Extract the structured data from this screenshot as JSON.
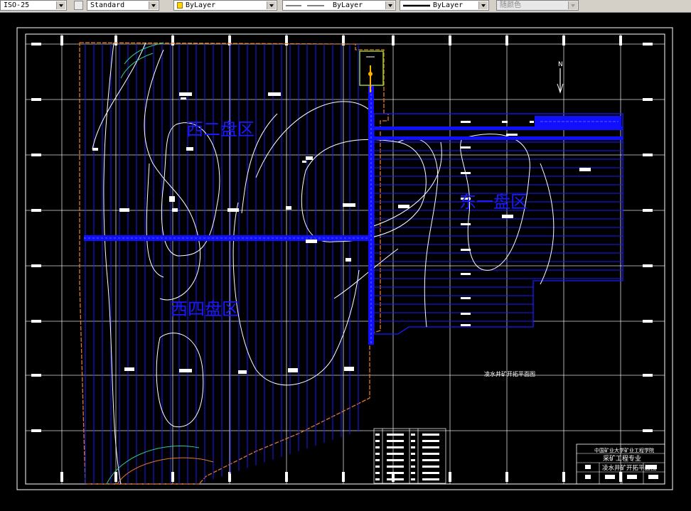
{
  "toolbar": {
    "dimstyle": "ISO-25",
    "textstyle": "Standard",
    "layer_color": "ByLayer",
    "linetype": "ByLayer",
    "lineweight": "ByLayer",
    "plotstyle": "随颜色",
    "colors": {
      "layer_swatch": "#ffd400",
      "toolbar_bg": "#d4d0c8"
    }
  },
  "drawing": {
    "north_label": "N",
    "area_labels": {
      "west2": "西二盘区",
      "east1": "东一盘区",
      "west4": "西四盘区"
    },
    "drawing_caption": "凌水井矿开拓平面图",
    "title_block": {
      "school": "中国矿业大学矿业工程学院",
      "major": "采矿工程专业",
      "title": "凌水井矿开拓平面图"
    },
    "colors": {
      "background": "#000000",
      "panel_lines": "#1010ff",
      "roadway": "#0000ff",
      "contours": "#ffffff",
      "boundary": "#e07a2a",
      "grid": "#ffffff",
      "shaft_box": "#9acd32",
      "shaft": "#ffb000",
      "area_label": "#0000ff"
    }
  }
}
